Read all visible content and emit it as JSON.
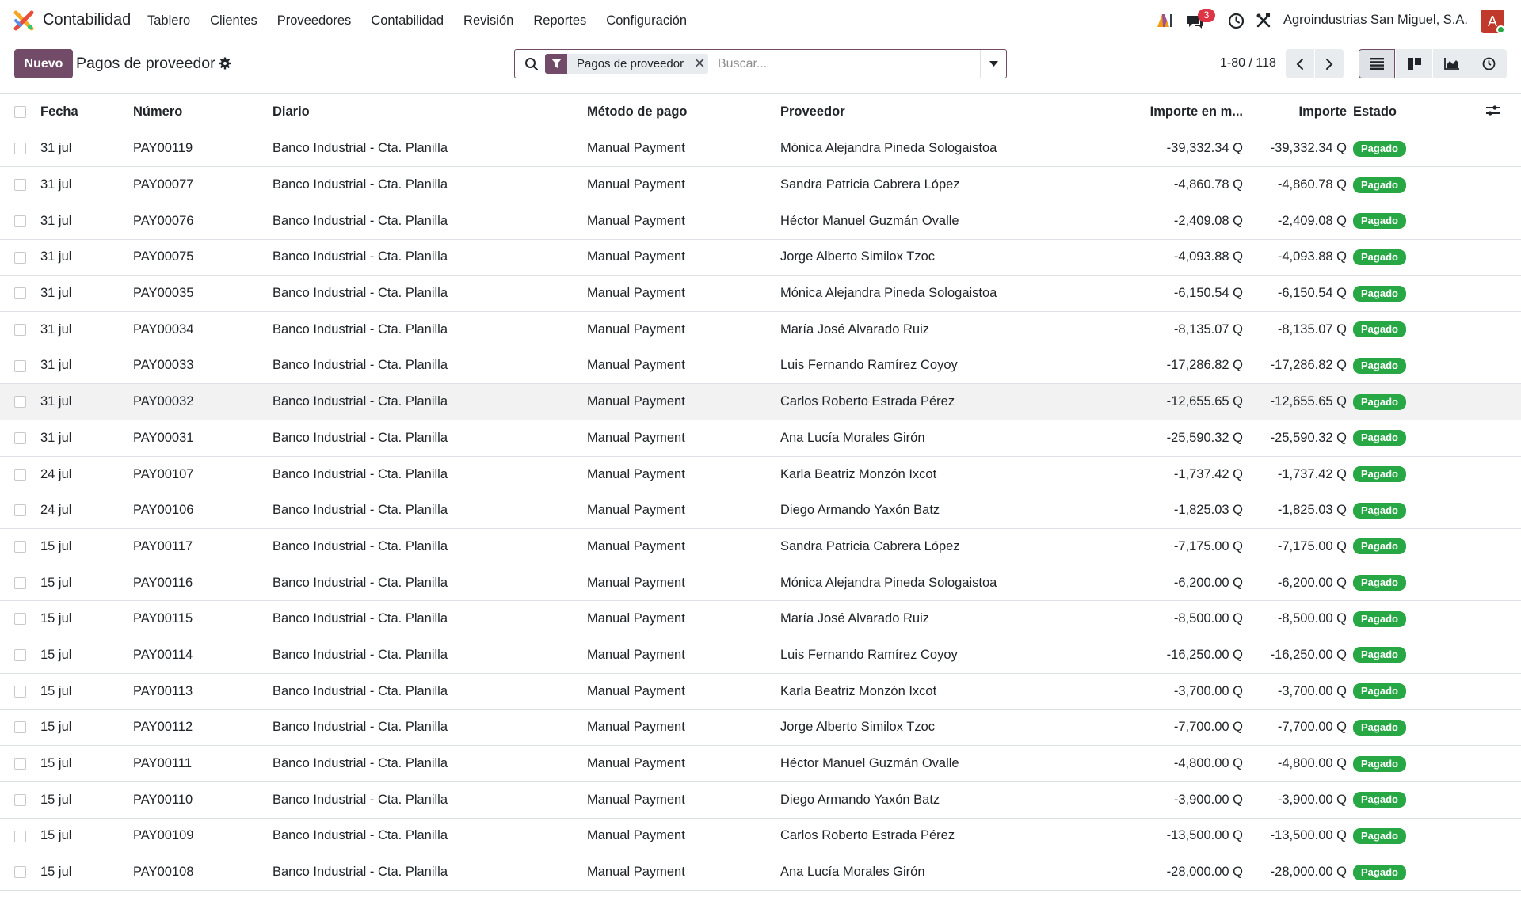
{
  "navbar": {
    "app_name": "Contabilidad",
    "menu": [
      "Tablero",
      "Clientes",
      "Proveedores",
      "Contabilidad",
      "Revisión",
      "Reportes",
      "Configuración"
    ],
    "chat_badge": "3",
    "company": "Agroindustrias San Miguel, S.A.",
    "avatar_letter": "A",
    "logo_colors": [
      "#f5a623",
      "#e74c3c",
      "#5b8def",
      "#2ecc71"
    ]
  },
  "control": {
    "new_label": "Nuevo",
    "title": "Pagos de proveedor",
    "facet_label": "Pagos de proveedor",
    "search_placeholder": "Buscar...",
    "pager": "1-80 / 118"
  },
  "table": {
    "headers": {
      "fecha": "Fecha",
      "numero": "Número",
      "diario": "Diario",
      "metodo": "Método de pago",
      "proveedor": "Proveedor",
      "importe_moneda": "Importe en m...",
      "importe": "Importe",
      "estado": "Estado"
    },
    "rows": [
      {
        "fecha": "31 jul",
        "numero": "PAY00119",
        "diario": "Banco Industrial - Cta. Planilla",
        "metodo": "Manual Payment",
        "proveedor": "Mónica Alejandra Pineda Sologaistoa",
        "importe_moneda": "-39,332.34 Q",
        "importe": "-39,332.34 Q",
        "estado": "Pagado"
      },
      {
        "fecha": "31 jul",
        "numero": "PAY00077",
        "diario": "Banco Industrial - Cta. Planilla",
        "metodo": "Manual Payment",
        "proveedor": "Sandra Patricia Cabrera López",
        "importe_moneda": "-4,860.78 Q",
        "importe": "-4,860.78 Q",
        "estado": "Pagado"
      },
      {
        "fecha": "31 jul",
        "numero": "PAY00076",
        "diario": "Banco Industrial - Cta. Planilla",
        "metodo": "Manual Payment",
        "proveedor": "Héctor Manuel Guzmán Ovalle",
        "importe_moneda": "-2,409.08 Q",
        "importe": "-2,409.08 Q",
        "estado": "Pagado"
      },
      {
        "fecha": "31 jul",
        "numero": "PAY00075",
        "diario": "Banco Industrial - Cta. Planilla",
        "metodo": "Manual Payment",
        "proveedor": "Jorge Alberto Similox Tzoc",
        "importe_moneda": "-4,093.88 Q",
        "importe": "-4,093.88 Q",
        "estado": "Pagado"
      },
      {
        "fecha": "31 jul",
        "numero": "PAY00035",
        "diario": "Banco Industrial - Cta. Planilla",
        "metodo": "Manual Payment",
        "proveedor": "Mónica Alejandra Pineda Sologaistoa",
        "importe_moneda": "-6,150.54 Q",
        "importe": "-6,150.54 Q",
        "estado": "Pagado"
      },
      {
        "fecha": "31 jul",
        "numero": "PAY00034",
        "diario": "Banco Industrial - Cta. Planilla",
        "metodo": "Manual Payment",
        "proveedor": "María José Alvarado Ruiz",
        "importe_moneda": "-8,135.07 Q",
        "importe": "-8,135.07 Q",
        "estado": "Pagado"
      },
      {
        "fecha": "31 jul",
        "numero": "PAY00033",
        "diario": "Banco Industrial - Cta. Planilla",
        "metodo": "Manual Payment",
        "proveedor": "Luis Fernando Ramírez Coyoy",
        "importe_moneda": "-17,286.82 Q",
        "importe": "-17,286.82 Q",
        "estado": "Pagado"
      },
      {
        "fecha": "31 jul",
        "numero": "PAY00032",
        "diario": "Banco Industrial - Cta. Planilla",
        "metodo": "Manual Payment",
        "proveedor": "Carlos Roberto Estrada Pérez",
        "importe_moneda": "-12,655.65 Q",
        "importe": "-12,655.65 Q",
        "estado": "Pagado"
      },
      {
        "fecha": "31 jul",
        "numero": "PAY00031",
        "diario": "Banco Industrial - Cta. Planilla",
        "metodo": "Manual Payment",
        "proveedor": "Ana Lucía Morales Girón",
        "importe_moneda": "-25,590.32 Q",
        "importe": "-25,590.32 Q",
        "estado": "Pagado"
      },
      {
        "fecha": "24 jul",
        "numero": "PAY00107",
        "diario": "Banco Industrial - Cta. Planilla",
        "metodo": "Manual Payment",
        "proveedor": "Karla Beatriz Monzón Ixcot",
        "importe_moneda": "-1,737.42 Q",
        "importe": "-1,737.42 Q",
        "estado": "Pagado"
      },
      {
        "fecha": "24 jul",
        "numero": "PAY00106",
        "diario": "Banco Industrial - Cta. Planilla",
        "metodo": "Manual Payment",
        "proveedor": "Diego Armando Yaxón Batz",
        "importe_moneda": "-1,825.03 Q",
        "importe": "-1,825.03 Q",
        "estado": "Pagado"
      },
      {
        "fecha": "15 jul",
        "numero": "PAY00117",
        "diario": "Banco Industrial - Cta. Planilla",
        "metodo": "Manual Payment",
        "proveedor": "Sandra Patricia Cabrera López",
        "importe_moneda": "-7,175.00 Q",
        "importe": "-7,175.00 Q",
        "estado": "Pagado"
      },
      {
        "fecha": "15 jul",
        "numero": "PAY00116",
        "diario": "Banco Industrial - Cta. Planilla",
        "metodo": "Manual Payment",
        "proveedor": "Mónica Alejandra Pineda Sologaistoa",
        "importe_moneda": "-6,200.00 Q",
        "importe": "-6,200.00 Q",
        "estado": "Pagado"
      },
      {
        "fecha": "15 jul",
        "numero": "PAY00115",
        "diario": "Banco Industrial - Cta. Planilla",
        "metodo": "Manual Payment",
        "proveedor": "María José Alvarado Ruiz",
        "importe_moneda": "-8,500.00 Q",
        "importe": "-8,500.00 Q",
        "estado": "Pagado"
      },
      {
        "fecha": "15 jul",
        "numero": "PAY00114",
        "diario": "Banco Industrial - Cta. Planilla",
        "metodo": "Manual Payment",
        "proveedor": "Luis Fernando Ramírez Coyoy",
        "importe_moneda": "-16,250.00 Q",
        "importe": "-16,250.00 Q",
        "estado": "Pagado"
      },
      {
        "fecha": "15 jul",
        "numero": "PAY00113",
        "diario": "Banco Industrial - Cta. Planilla",
        "metodo": "Manual Payment",
        "proveedor": "Karla Beatriz Monzón Ixcot",
        "importe_moneda": "-3,700.00 Q",
        "importe": "-3,700.00 Q",
        "estado": "Pagado"
      },
      {
        "fecha": "15 jul",
        "numero": "PAY00112",
        "diario": "Banco Industrial - Cta. Planilla",
        "metodo": "Manual Payment",
        "proveedor": "Jorge Alberto Similox Tzoc",
        "importe_moneda": "-7,700.00 Q",
        "importe": "-7,700.00 Q",
        "estado": "Pagado"
      },
      {
        "fecha": "15 jul",
        "numero": "PAY00111",
        "diario": "Banco Industrial - Cta. Planilla",
        "metodo": "Manual Payment",
        "proveedor": "Héctor Manuel Guzmán Ovalle",
        "importe_moneda": "-4,800.00 Q",
        "importe": "-4,800.00 Q",
        "estado": "Pagado"
      },
      {
        "fecha": "15 jul",
        "numero": "PAY00110",
        "diario": "Banco Industrial - Cta. Planilla",
        "metodo": "Manual Payment",
        "proveedor": "Diego Armando Yaxón Batz",
        "importe_moneda": "-3,900.00 Q",
        "importe": "-3,900.00 Q",
        "estado": "Pagado"
      },
      {
        "fecha": "15 jul",
        "numero": "PAY00109",
        "diario": "Banco Industrial - Cta. Planilla",
        "metodo": "Manual Payment",
        "proveedor": "Carlos Roberto Estrada Pérez",
        "importe_moneda": "-13,500.00 Q",
        "importe": "-13,500.00 Q",
        "estado": "Pagado"
      },
      {
        "fecha": "15 jul",
        "numero": "PAY00108",
        "diario": "Banco Industrial - Cta. Planilla",
        "metodo": "Manual Payment",
        "proveedor": "Ana Lucía Morales Girón",
        "importe_moneda": "-28,000.00 Q",
        "importe": "-28,000.00 Q",
        "estado": "Pagado"
      }
    ]
  },
  "colors": {
    "brand": "#714b67",
    "status_paid": "#28a745",
    "badge_red": "#dc3545"
  }
}
